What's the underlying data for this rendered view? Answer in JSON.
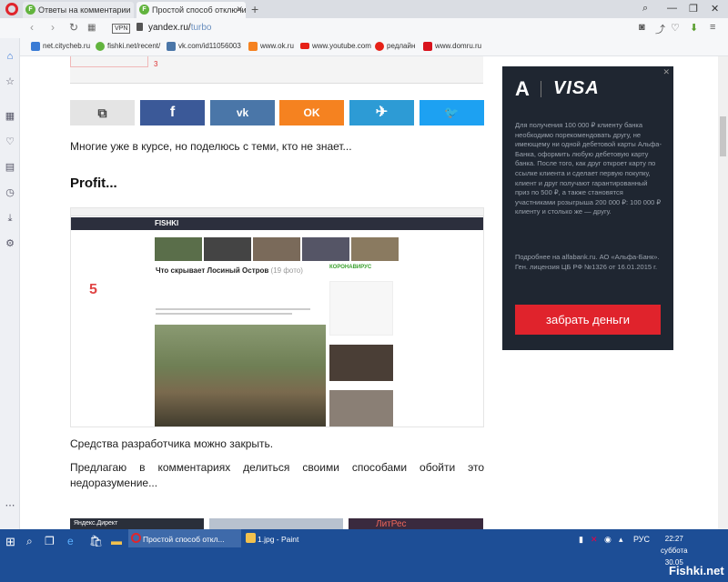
{
  "tabs": [
    {
      "title": "Ответы на комментарии",
      "active": false
    },
    {
      "title": "Простой способ отключить",
      "active": true
    }
  ],
  "address": {
    "vpn": "VPN",
    "host": "yandex.ru/",
    "path": "turbo"
  },
  "bookmarks": [
    {
      "label": "net.citycheb.ru",
      "color": "#3a7bd5"
    },
    {
      "label": "fishki.net/recent/",
      "color": "#62b43e"
    },
    {
      "label": "vk.com/id11056003",
      "color": "#4a76a8"
    },
    {
      "label": "www.ok.ru",
      "color": "#f58220"
    },
    {
      "label": "www.youtube.com",
      "color": "#e62117"
    },
    {
      "label": "редлайн",
      "color": "#e62117"
    },
    {
      "label": "www.domru.ru",
      "color": "#d8131d"
    }
  ],
  "article": {
    "intro": "Многие уже в курсе, но поделюсь с теми, кто не знает...",
    "heading": "Profit...",
    "caption1": "Средства разработчика можно закрыть.",
    "caption2": "Предлагаю в комментариях делиться своими способами обойти это недоразумение..."
  },
  "share_buttons": [
    {
      "name": "copy",
      "symbol": "⧉",
      "color": "#e4e4e4"
    },
    {
      "name": "facebook",
      "symbol": "f",
      "color": "#3b5998"
    },
    {
      "name": "vk",
      "symbol": "vk",
      "color": "#4a76a8"
    },
    {
      "name": "odnoklassniki",
      "symbol": "OK",
      "color": "#f58220"
    },
    {
      "name": "telegram",
      "symbol": "✈",
      "color": "#2d9bd5"
    },
    {
      "name": "twitter",
      "symbol": "🐦",
      "color": "#1da1f2"
    }
  ],
  "screenshot": {
    "site": "FISHKI",
    "title": "Что скрывает Лосиный Остров",
    "photo_count": "(19 фото)",
    "number": "5",
    "badge": "КОРОНАВИРУС"
  },
  "ad": {
    "logo": "A",
    "brand": "VISA",
    "text": "Для получения 100 000 ₽ клиенту банка необходимо порекомендовать другу, не имеющему ни одной дебетовой карты Альфа-Банка, оформить любую дебетовую карту банка. После того, как друг откроет карту по ссылке клиента и сделает первую покупку, клиент и друг получают гарантированный приз по 500 ₽, а также становятся участниками розыгрыша 200 000 ₽: 100 000 ₽ клиенту и столько же — другу.",
    "legal": "Подробнее на alfabank.ru. АО «Альфа-Банк». Ген. лицензия ЦБ РФ №1326 от 16.01.2015 г.",
    "button": "забрать деньги"
  },
  "bottom_strip": {
    "label": "Яндекс.Директ",
    "brand": "ЛитРес"
  },
  "taskbar": {
    "apps": [
      {
        "label": "Простой способ откл...",
        "active": true,
        "color": "#e0252c"
      },
      {
        "label": "1.jpg - Paint",
        "active": false,
        "color": "#f2c14e"
      }
    ],
    "lang": "РУС",
    "time": "22:27",
    "day": "суббота",
    "date": "30.05",
    "watermark": "Fishki.net"
  }
}
